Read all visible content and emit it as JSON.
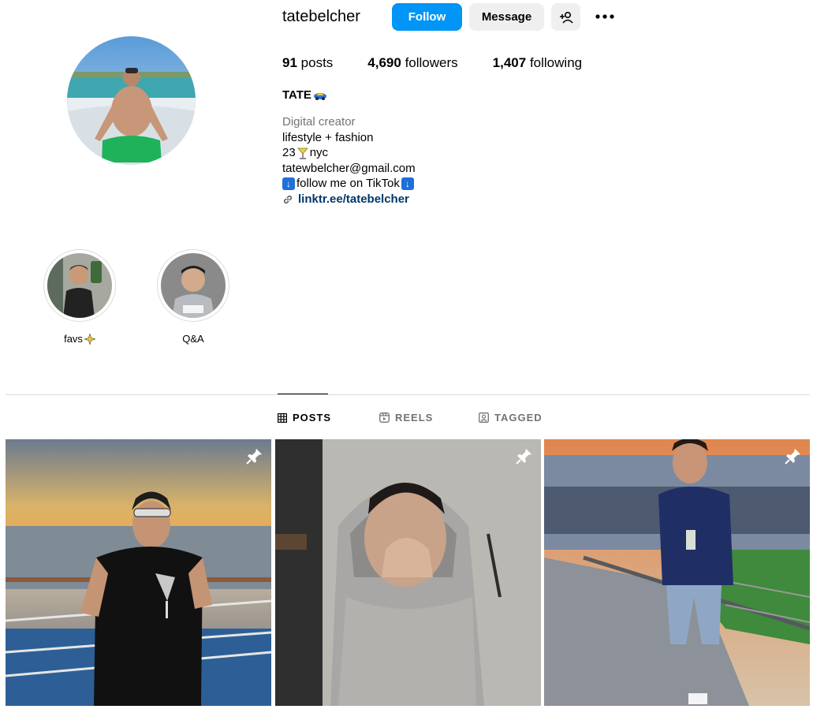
{
  "profile": {
    "username": "tatebelcher",
    "follow_label": "Follow",
    "message_label": "Message",
    "stats": {
      "posts_count": "91",
      "posts_label": "posts",
      "followers_count": "4,690",
      "followers_label": "followers",
      "following_count": "1,407",
      "following_label": "following"
    },
    "full_name": "TATE",
    "bio": {
      "category": "Digital creator",
      "line1": "lifestyle + fashion",
      "line2_prefix": "23",
      "line2_suffix": "nyc",
      "line3": "tatewbelcher@gmail.com",
      "line4": "follow me on TikTok",
      "link": "linktr.ee/tatebelcher"
    }
  },
  "highlights": [
    {
      "label": "favs"
    },
    {
      "label": "Q&A"
    }
  ],
  "tabs": [
    {
      "label": "POSTS",
      "active": true
    },
    {
      "label": "REELS",
      "active": false
    },
    {
      "label": "TAGGED",
      "active": false
    }
  ],
  "colors": {
    "follow_blue": "#0095f6",
    "button_gray": "#efefef",
    "link_blue": "#00376b",
    "muted_text": "#737373"
  },
  "posts": [
    {
      "pinned": true
    },
    {
      "pinned": true
    },
    {
      "pinned": true
    }
  ]
}
